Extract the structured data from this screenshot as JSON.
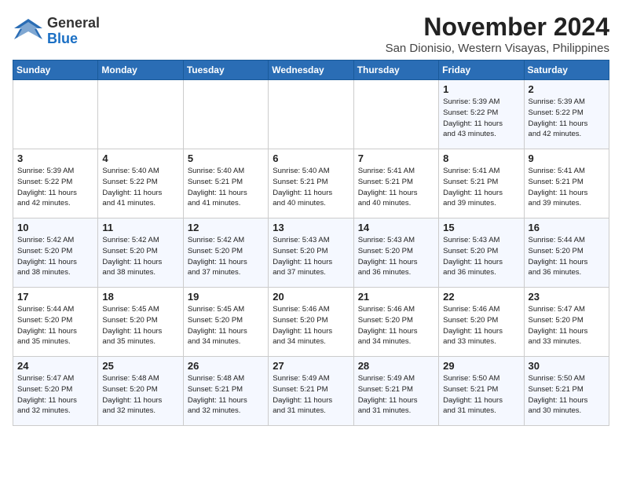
{
  "logo": {
    "general": "General",
    "blue": "Blue"
  },
  "title": "November 2024",
  "location": "San Dionisio, Western Visayas, Philippines",
  "days_of_week": [
    "Sunday",
    "Monday",
    "Tuesday",
    "Wednesday",
    "Thursday",
    "Friday",
    "Saturday"
  ],
  "weeks": [
    [
      {
        "num": "",
        "detail": ""
      },
      {
        "num": "",
        "detail": ""
      },
      {
        "num": "",
        "detail": ""
      },
      {
        "num": "",
        "detail": ""
      },
      {
        "num": "",
        "detail": ""
      },
      {
        "num": "1",
        "detail": "Sunrise: 5:39 AM\nSunset: 5:22 PM\nDaylight: 11 hours\nand 43 minutes."
      },
      {
        "num": "2",
        "detail": "Sunrise: 5:39 AM\nSunset: 5:22 PM\nDaylight: 11 hours\nand 42 minutes."
      }
    ],
    [
      {
        "num": "3",
        "detail": "Sunrise: 5:39 AM\nSunset: 5:22 PM\nDaylight: 11 hours\nand 42 minutes."
      },
      {
        "num": "4",
        "detail": "Sunrise: 5:40 AM\nSunset: 5:22 PM\nDaylight: 11 hours\nand 41 minutes."
      },
      {
        "num": "5",
        "detail": "Sunrise: 5:40 AM\nSunset: 5:21 PM\nDaylight: 11 hours\nand 41 minutes."
      },
      {
        "num": "6",
        "detail": "Sunrise: 5:40 AM\nSunset: 5:21 PM\nDaylight: 11 hours\nand 40 minutes."
      },
      {
        "num": "7",
        "detail": "Sunrise: 5:41 AM\nSunset: 5:21 PM\nDaylight: 11 hours\nand 40 minutes."
      },
      {
        "num": "8",
        "detail": "Sunrise: 5:41 AM\nSunset: 5:21 PM\nDaylight: 11 hours\nand 39 minutes."
      },
      {
        "num": "9",
        "detail": "Sunrise: 5:41 AM\nSunset: 5:21 PM\nDaylight: 11 hours\nand 39 minutes."
      }
    ],
    [
      {
        "num": "10",
        "detail": "Sunrise: 5:42 AM\nSunset: 5:20 PM\nDaylight: 11 hours\nand 38 minutes."
      },
      {
        "num": "11",
        "detail": "Sunrise: 5:42 AM\nSunset: 5:20 PM\nDaylight: 11 hours\nand 38 minutes."
      },
      {
        "num": "12",
        "detail": "Sunrise: 5:42 AM\nSunset: 5:20 PM\nDaylight: 11 hours\nand 37 minutes."
      },
      {
        "num": "13",
        "detail": "Sunrise: 5:43 AM\nSunset: 5:20 PM\nDaylight: 11 hours\nand 37 minutes."
      },
      {
        "num": "14",
        "detail": "Sunrise: 5:43 AM\nSunset: 5:20 PM\nDaylight: 11 hours\nand 36 minutes."
      },
      {
        "num": "15",
        "detail": "Sunrise: 5:43 AM\nSunset: 5:20 PM\nDaylight: 11 hours\nand 36 minutes."
      },
      {
        "num": "16",
        "detail": "Sunrise: 5:44 AM\nSunset: 5:20 PM\nDaylight: 11 hours\nand 36 minutes."
      }
    ],
    [
      {
        "num": "17",
        "detail": "Sunrise: 5:44 AM\nSunset: 5:20 PM\nDaylight: 11 hours\nand 35 minutes."
      },
      {
        "num": "18",
        "detail": "Sunrise: 5:45 AM\nSunset: 5:20 PM\nDaylight: 11 hours\nand 35 minutes."
      },
      {
        "num": "19",
        "detail": "Sunrise: 5:45 AM\nSunset: 5:20 PM\nDaylight: 11 hours\nand 34 minutes."
      },
      {
        "num": "20",
        "detail": "Sunrise: 5:46 AM\nSunset: 5:20 PM\nDaylight: 11 hours\nand 34 minutes."
      },
      {
        "num": "21",
        "detail": "Sunrise: 5:46 AM\nSunset: 5:20 PM\nDaylight: 11 hours\nand 34 minutes."
      },
      {
        "num": "22",
        "detail": "Sunrise: 5:46 AM\nSunset: 5:20 PM\nDaylight: 11 hours\nand 33 minutes."
      },
      {
        "num": "23",
        "detail": "Sunrise: 5:47 AM\nSunset: 5:20 PM\nDaylight: 11 hours\nand 33 minutes."
      }
    ],
    [
      {
        "num": "24",
        "detail": "Sunrise: 5:47 AM\nSunset: 5:20 PM\nDaylight: 11 hours\nand 32 minutes."
      },
      {
        "num": "25",
        "detail": "Sunrise: 5:48 AM\nSunset: 5:20 PM\nDaylight: 11 hours\nand 32 minutes."
      },
      {
        "num": "26",
        "detail": "Sunrise: 5:48 AM\nSunset: 5:21 PM\nDaylight: 11 hours\nand 32 minutes."
      },
      {
        "num": "27",
        "detail": "Sunrise: 5:49 AM\nSunset: 5:21 PM\nDaylight: 11 hours\nand 31 minutes."
      },
      {
        "num": "28",
        "detail": "Sunrise: 5:49 AM\nSunset: 5:21 PM\nDaylight: 11 hours\nand 31 minutes."
      },
      {
        "num": "29",
        "detail": "Sunrise: 5:50 AM\nSunset: 5:21 PM\nDaylight: 11 hours\nand 31 minutes."
      },
      {
        "num": "30",
        "detail": "Sunrise: 5:50 AM\nSunset: 5:21 PM\nDaylight: 11 hours\nand 30 minutes."
      }
    ]
  ]
}
